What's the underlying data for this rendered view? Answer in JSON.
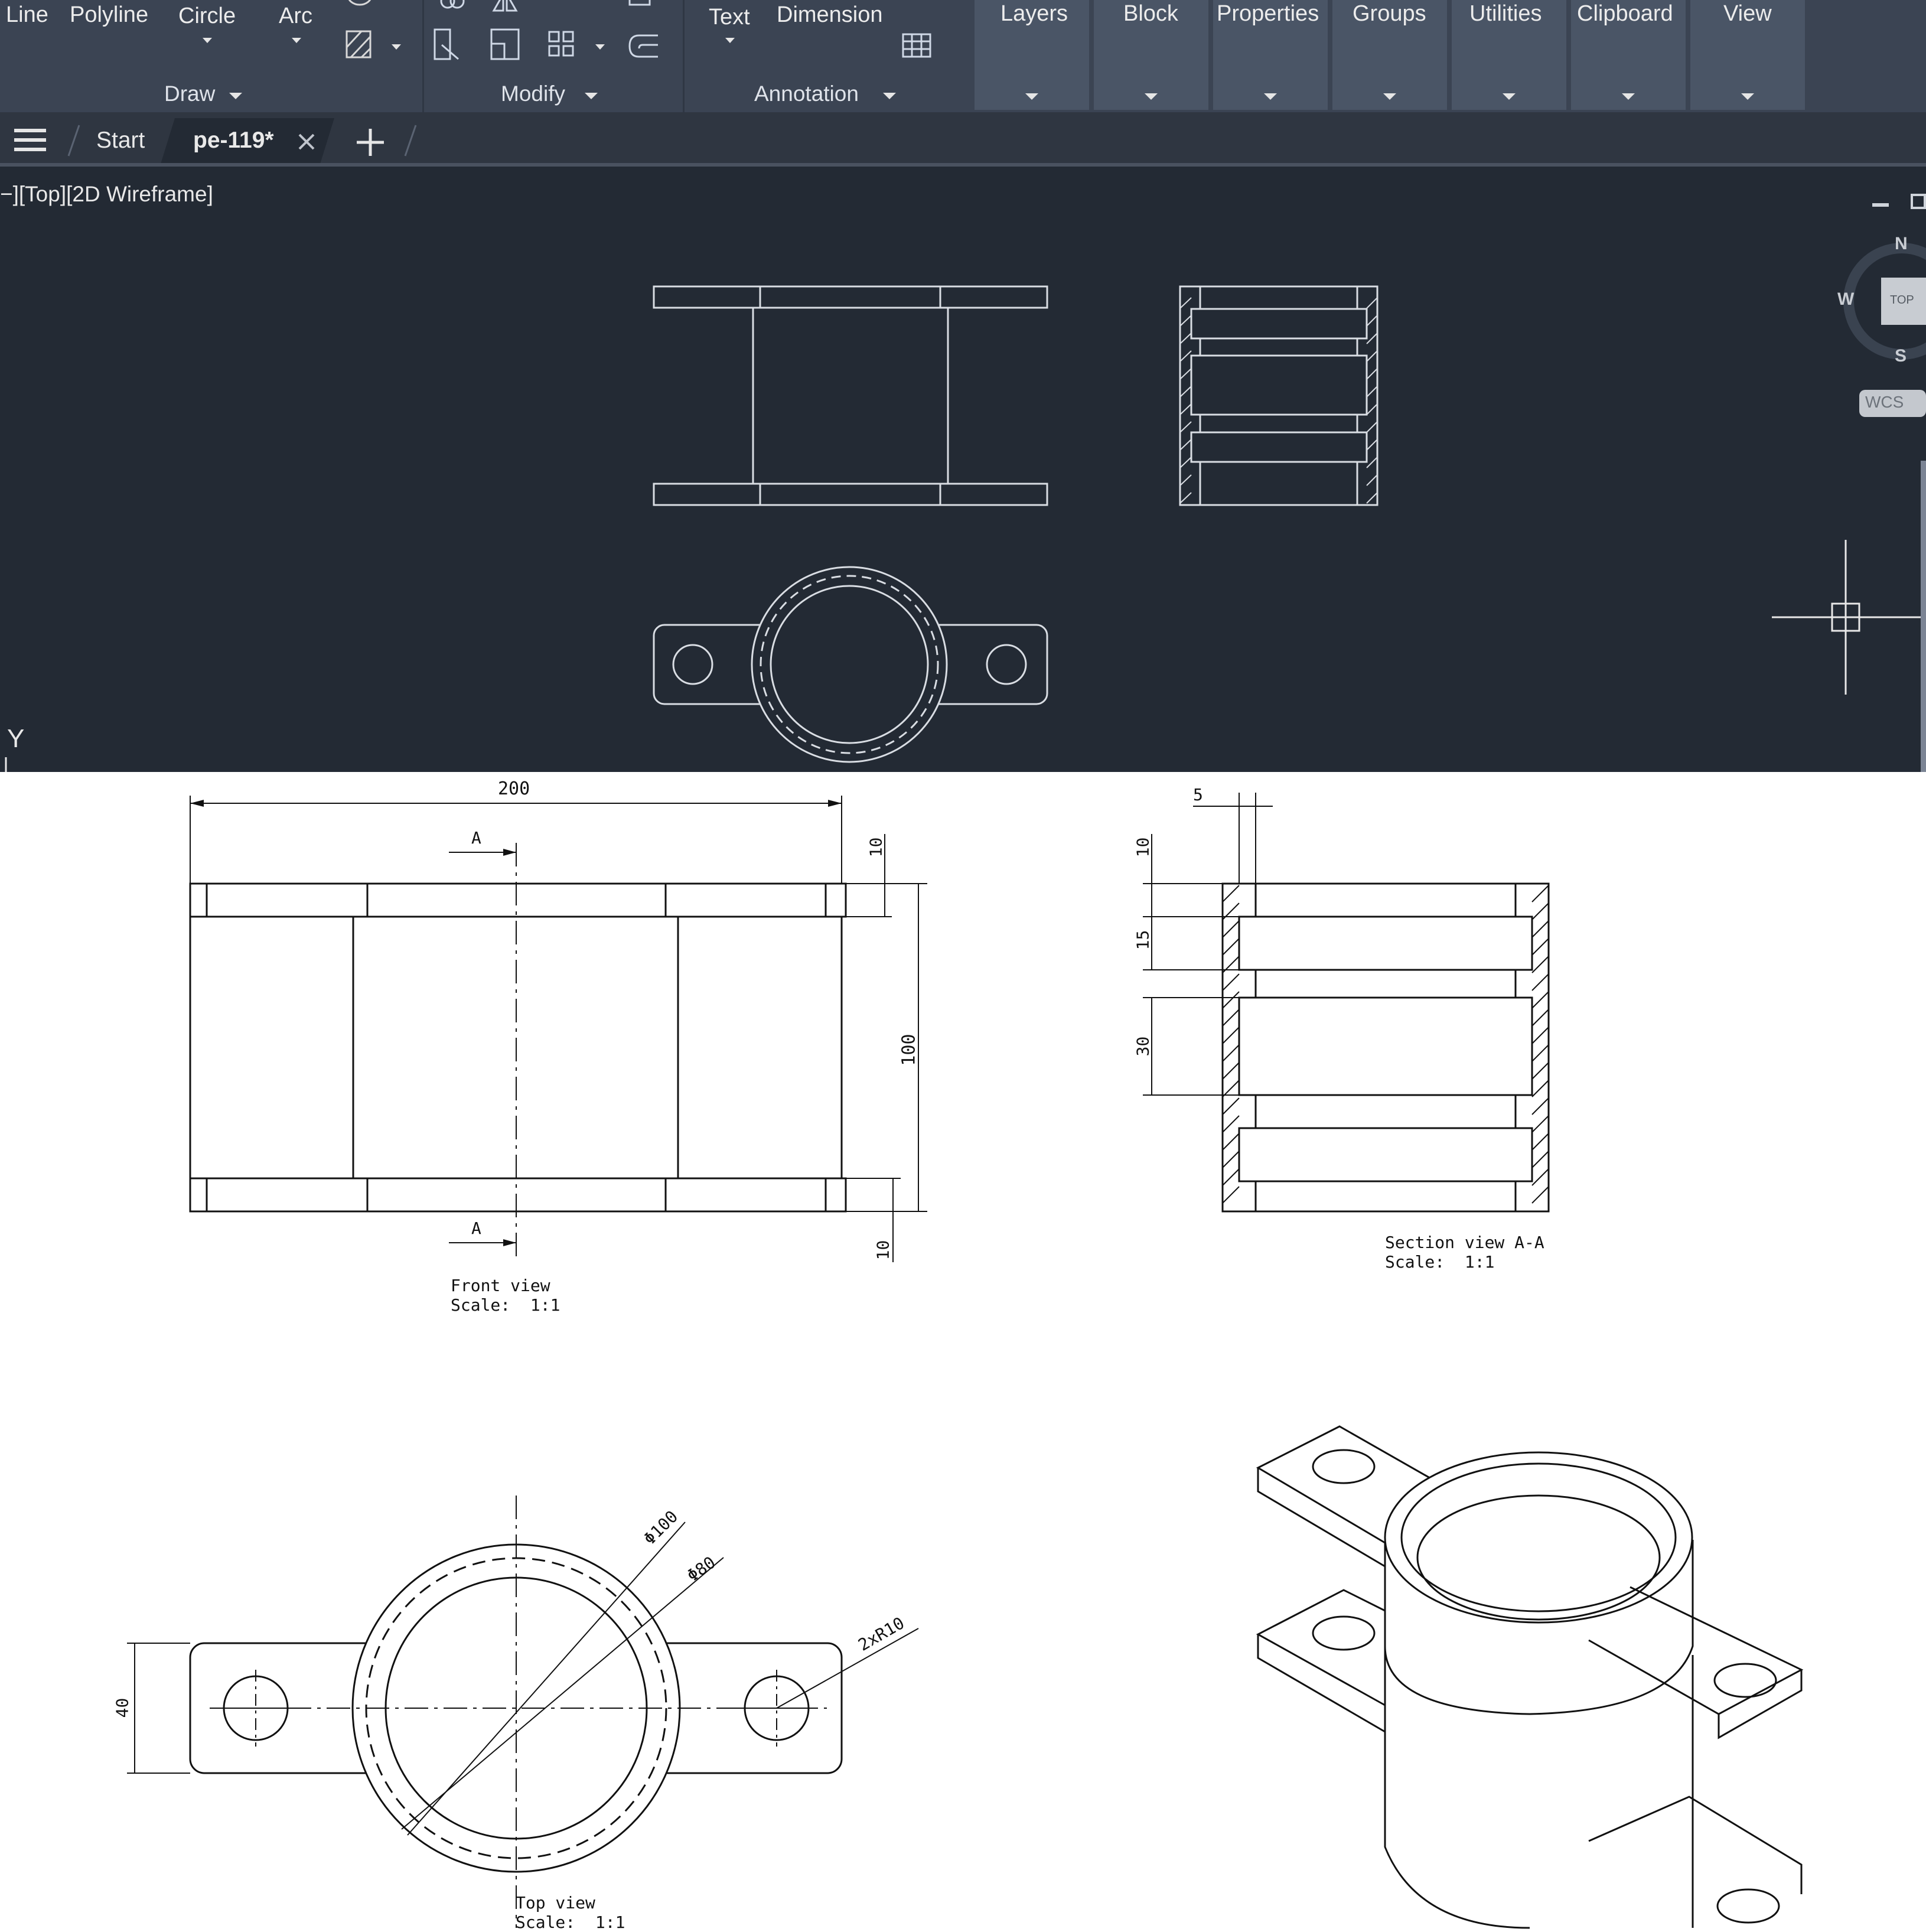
{
  "ribbon": {
    "draw_buttons": [
      "Line",
      "Polyline",
      "Circle",
      "Arc"
    ],
    "panels": {
      "draw": "Draw",
      "modify": "Modify",
      "annotation": "Annotation"
    },
    "annotation_buttons": [
      "Text",
      "Dimension"
    ],
    "tool_panels": [
      "Layers",
      "Block",
      "Properties",
      "Groups",
      "Utilities",
      "Clipboard",
      "View"
    ]
  },
  "tabs": {
    "start": "Start",
    "active": "pe-119*"
  },
  "viewport": {
    "label": "−][Top][2D Wireframe]",
    "viewcube": {
      "n": "N",
      "w": "W",
      "s": "S",
      "face": "TOP",
      "wcs": "WCS"
    },
    "ucs_y": "Y"
  },
  "drawing": {
    "front": {
      "dim_width": "200",
      "dim_height": "100",
      "dim_top": "10",
      "dim_bottom": "10",
      "section_mark": "A",
      "title": "Front view",
      "scale": "Scale:  1:1"
    },
    "section": {
      "dim_wall": "5",
      "dim_a": "10",
      "dim_b": "15",
      "dim_c": "30",
      "title": "Section view A-A",
      "scale": "Scale:  1:1"
    },
    "top": {
      "dim_outer": "Φ100",
      "dim_inner": "Φ80",
      "dim_holes": "2xR10",
      "dim_height": "40",
      "title": "Top view",
      "scale": "Scale:  1:1"
    }
  },
  "colors": {
    "ribbon": "#3b4453",
    "panel": "#4a5566",
    "tabbar": "#2f3641",
    "viewport": "#232a34"
  }
}
